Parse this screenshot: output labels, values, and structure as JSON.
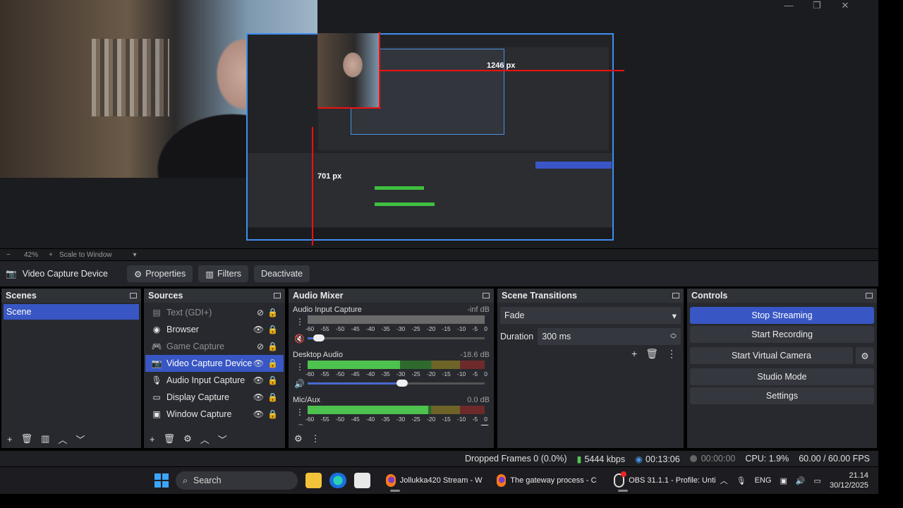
{
  "window": {
    "minimize": "—",
    "maximize": "❐",
    "close": "✕"
  },
  "preview": {
    "measure_width": "1246 px",
    "measure_height": "701 px"
  },
  "zoom": {
    "minus": "−",
    "level": "42%",
    "plus": "+",
    "mode": "Scale to Window",
    "caret": "▾"
  },
  "source_toolbar": {
    "current_source": "Video Capture Device",
    "properties": "Properties",
    "filters": "Filters",
    "deactivate": "Deactivate"
  },
  "scenes": {
    "title": "Scenes",
    "items": [
      {
        "label": "Scene"
      }
    ]
  },
  "sources": {
    "title": "Sources",
    "items": [
      {
        "label": "Text (GDI+)",
        "icon": "text-icon"
      },
      {
        "label": "Browser",
        "icon": "globe-icon"
      },
      {
        "label": "Game Capture",
        "icon": "gamepad-icon"
      },
      {
        "label": "Video Capture Device",
        "icon": "camera-icon"
      },
      {
        "label": "Audio Input Capture",
        "icon": "microphone-icon"
      },
      {
        "label": "Display Capture",
        "icon": "monitor-icon"
      },
      {
        "label": "Window Capture",
        "icon": "window-icon"
      }
    ]
  },
  "mixer": {
    "title": "Audio Mixer",
    "scale": [
      "-60",
      "-55",
      "-50",
      "-45",
      "-40",
      "-35",
      "-30",
      "-25",
      "-20",
      "-15",
      "-10",
      "-5",
      "0"
    ],
    "channels": [
      {
        "name": "Audio Input Capture",
        "db": "-inf dB",
        "level": 0,
        "volume": 0.03
      },
      {
        "name": "Desktop Audio",
        "db": "-18.6 dB",
        "level": 0.52,
        "volume": 0.5
      },
      {
        "name": "Mic/Aux",
        "db": "0.0 dB",
        "level": 0.68,
        "volume": 1.0
      }
    ]
  },
  "transitions": {
    "title": "Scene Transitions",
    "selected": "Fade",
    "duration_label": "Duration",
    "duration_value": "300 ms"
  },
  "controls": {
    "title": "Controls",
    "stop_streaming": "Stop Streaming",
    "start_recording": "Start Recording",
    "start_virtual_camera": "Start Virtual Camera",
    "studio_mode": "Studio Mode",
    "settings": "Settings"
  },
  "status": {
    "dropped": "Dropped Frames 0 (0.0%)",
    "bitrate": "5444 kbps",
    "stream_time": "00:13:06",
    "rec_time": "00:00:00",
    "cpu": "CPU: 1.9%",
    "fps": "60.00 / 60.00 FPS"
  },
  "taskbar": {
    "search": "Search",
    "apps": [
      {
        "label": "Jollukka420 Stream - W"
      },
      {
        "label": "The gateway process - C"
      },
      {
        "label": "OBS 31.1.1 - Profile: Unti"
      }
    ],
    "language": "ENG",
    "time": "21.14",
    "date": "30/12/2025"
  },
  "colors": {
    "accent": "#3857c4",
    "meter_green": "#4ec24e",
    "preview_border": "#3e8ef0"
  }
}
